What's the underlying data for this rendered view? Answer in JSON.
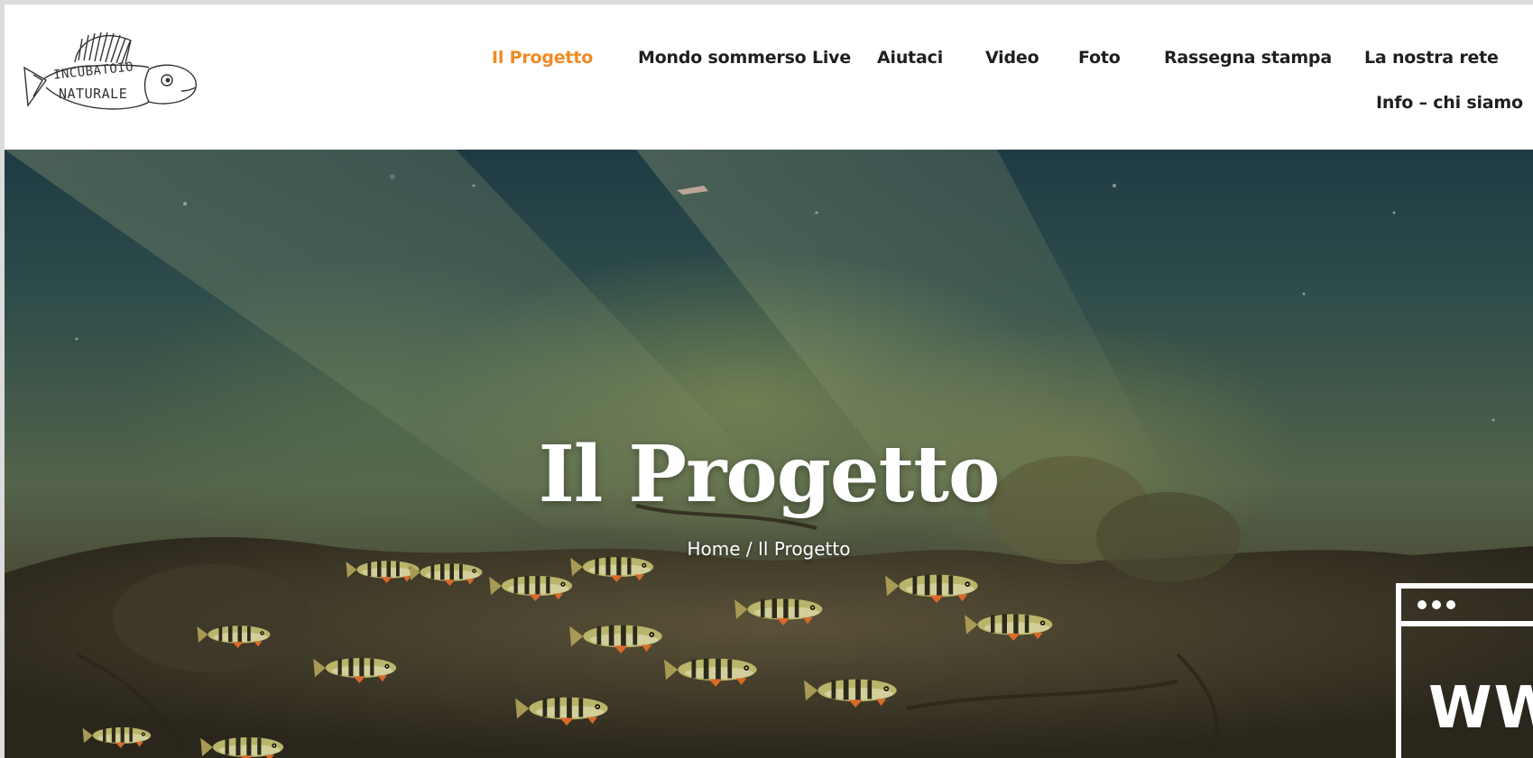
{
  "logo": {
    "line1": "INCUBATOIO",
    "line2": "NATURALE"
  },
  "nav": {
    "items": [
      {
        "label": "Il Progetto",
        "active": true
      },
      {
        "label": "Mondo sommerso Live"
      },
      {
        "label": "Aiutaci"
      },
      {
        "label": "Video"
      },
      {
        "label": "Foto"
      },
      {
        "label": "Rassegna stampa"
      },
      {
        "label": "La nostra rete"
      },
      {
        "label": "Info – chi siamo"
      }
    ]
  },
  "hero": {
    "title": "Il Progetto",
    "breadcrumb": {
      "home": "Home",
      "separator": " / ",
      "current": "Il Progetto"
    }
  },
  "widget": {
    "text": "WW"
  },
  "colors": {
    "accent": "#f08a24",
    "nav_text": "#1f1f1f",
    "hero_text": "#ffffff"
  }
}
